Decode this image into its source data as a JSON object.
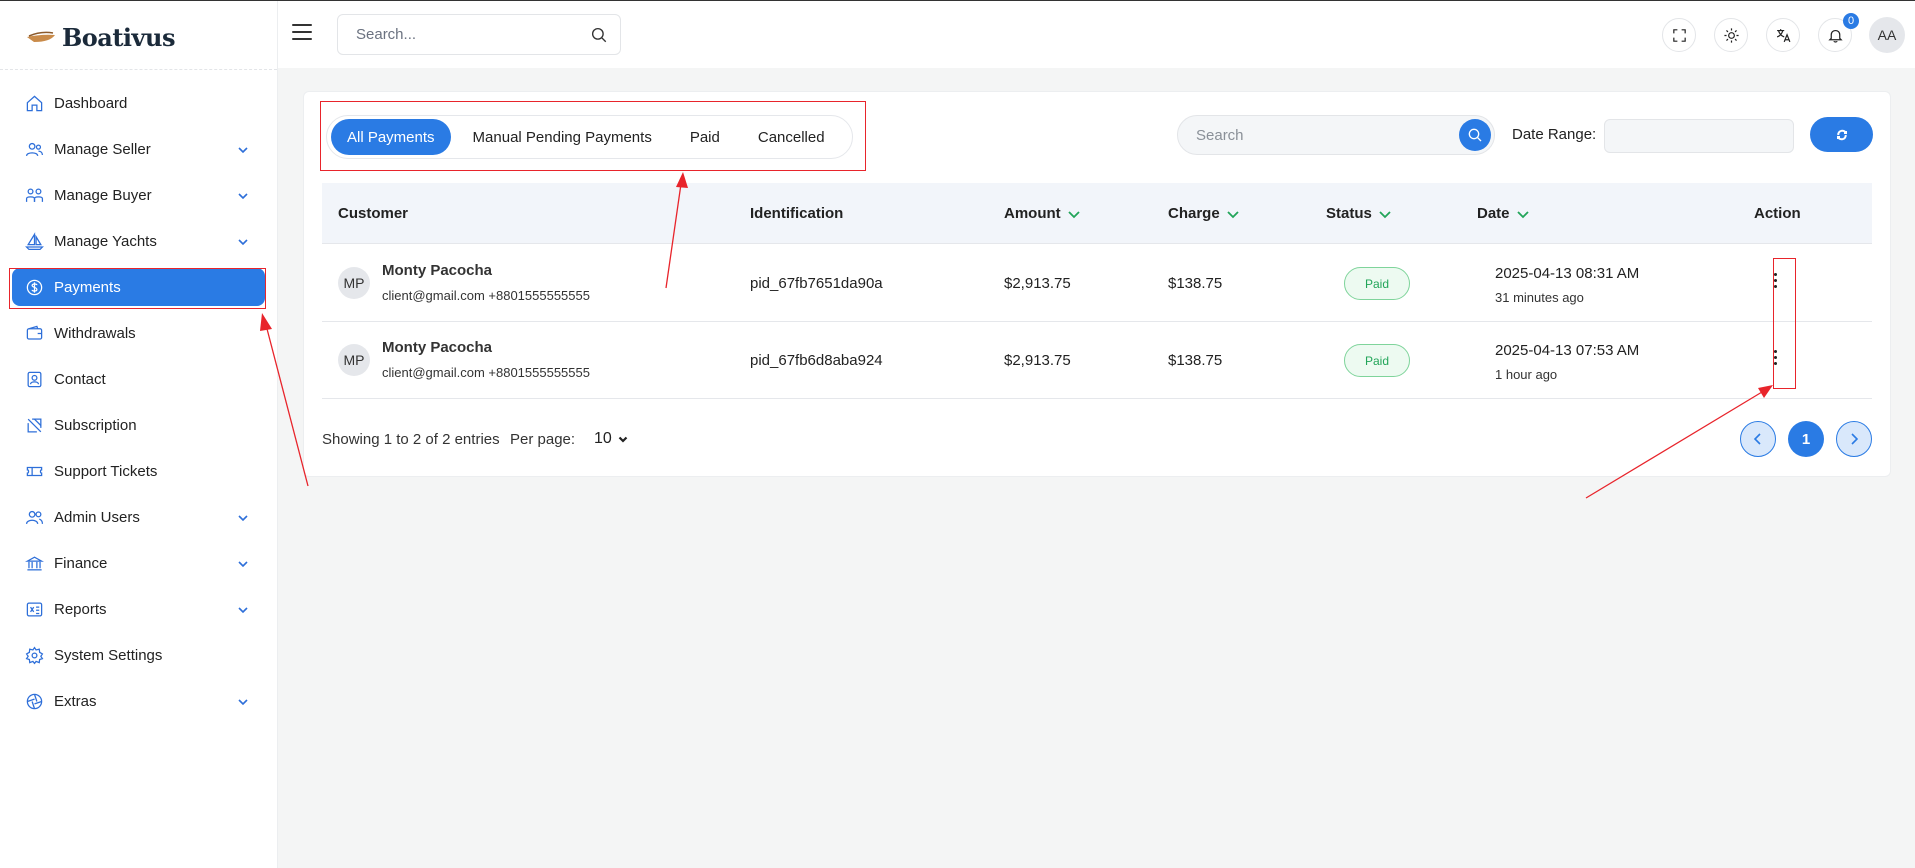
{
  "brand": {
    "name": "Boativus"
  },
  "topbar": {
    "search_placeholder": "Search...",
    "notifications_count": "0",
    "avatar_initials": "AA"
  },
  "sidebar": {
    "items": [
      {
        "label": "Dashboard",
        "icon": "home-icon",
        "has_submenu": false
      },
      {
        "label": "Manage Seller",
        "icon": "users-icon",
        "has_submenu": true
      },
      {
        "label": "Manage Buyer",
        "icon": "users-group-icon",
        "has_submenu": true
      },
      {
        "label": "Manage Yachts",
        "icon": "sailboat-icon",
        "has_submenu": true
      },
      {
        "label": "Payments",
        "icon": "dollar-circle-icon",
        "has_submenu": false,
        "active": true
      },
      {
        "label": "Withdrawals",
        "icon": "wallet-icon",
        "has_submenu": false
      },
      {
        "label": "Contact",
        "icon": "contact-card-icon",
        "has_submenu": false
      },
      {
        "label": "Subscription",
        "icon": "subscription-icon",
        "has_submenu": false
      },
      {
        "label": "Support Tickets",
        "icon": "ticket-icon",
        "has_submenu": false
      },
      {
        "label": "Admin Users",
        "icon": "admin-users-icon",
        "has_submenu": true
      },
      {
        "label": "Finance",
        "icon": "bank-icon",
        "has_submenu": true
      },
      {
        "label": "Reports",
        "icon": "report-icon",
        "has_submenu": true
      },
      {
        "label": "System Settings",
        "icon": "gear-icon",
        "has_submenu": false
      },
      {
        "label": "Extras",
        "icon": "aperture-icon",
        "has_submenu": true
      }
    ]
  },
  "tabs": [
    {
      "label": "All Payments",
      "active": true
    },
    {
      "label": "Manual Pending Payments",
      "active": false
    },
    {
      "label": "Paid",
      "active": false
    },
    {
      "label": "Cancelled",
      "active": false
    }
  ],
  "filters": {
    "search_placeholder": "Search",
    "date_range_label": "Date Range:",
    "date_range_value": ""
  },
  "table": {
    "headers": {
      "customer": "Customer",
      "identification": "Identification",
      "amount": "Amount",
      "charge": "Charge",
      "status": "Status",
      "date": "Date",
      "action": "Action"
    },
    "rows": [
      {
        "initials": "MP",
        "name": "Monty Pacocha",
        "contact": "client@gmail.com +8801555555555",
        "identification": "pid_67fb7651da90a",
        "amount": "$2,913.75",
        "charge": "$138.75",
        "status": "Paid",
        "date": "2025-04-13 08:31 AM",
        "relative": "31 minutes ago"
      },
      {
        "initials": "MP",
        "name": "Monty Pacocha",
        "contact": "client@gmail.com +8801555555555",
        "identification": "pid_67fb6d8aba924",
        "amount": "$2,913.75",
        "charge": "$138.75",
        "status": "Paid",
        "date": "2025-04-13 07:53 AM",
        "relative": "1 hour ago"
      }
    ]
  },
  "footer": {
    "showing": "Showing 1 to 2 of 2 entries",
    "per_page_label": "Per page:",
    "per_page_value": "10",
    "current_page": "1"
  },
  "colors": {
    "accent": "#2a7be4",
    "paid_green": "#22a559",
    "annotation_red": "#e8242b"
  }
}
